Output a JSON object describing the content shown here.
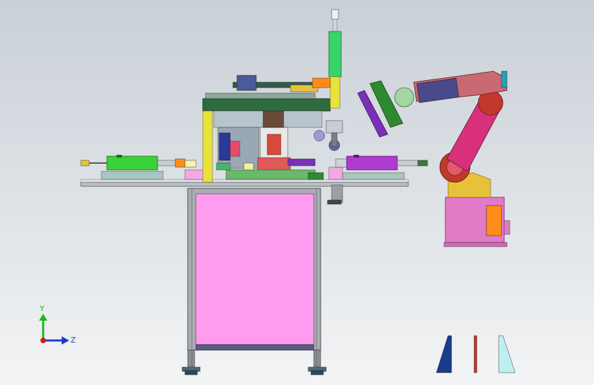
{
  "triad": {
    "y_label": "Y",
    "z_label": "Z",
    "colors": {
      "y": "#18b818",
      "z": "#1a3ccc",
      "origin": "#d21818"
    }
  },
  "palette": {
    "frame": "#8a8f96",
    "table_panel": "#ff9cf0",
    "table_top": "#9aa0a6",
    "deck": "#2f6b3f",
    "yellow_post": "#e8e23a",
    "green_cylinder": "#3ad13a",
    "purple_cylinder": "#b13ad1",
    "robot_base": "#e27ac8",
    "robot_arm": "#d8307a",
    "robot_joint": "#c0392b",
    "vertical_cylinder": "#39d36b",
    "gripper_purple": "#7a2fb8"
  },
  "icons": [
    "viewport-triad-icon",
    "view-orientation-wedge-icon"
  ]
}
